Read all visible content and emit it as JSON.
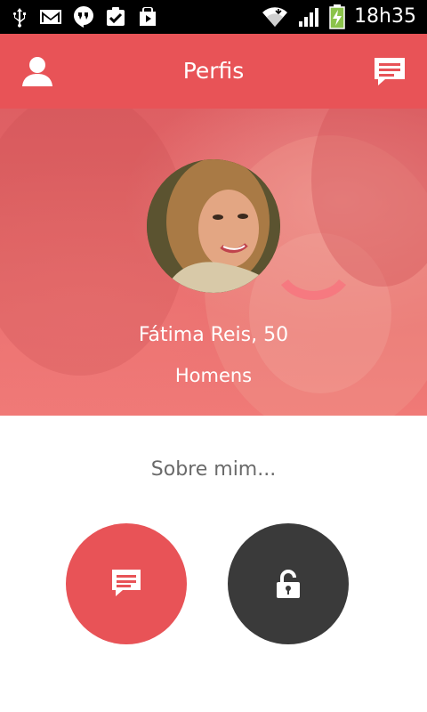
{
  "status_bar": {
    "time": "18h35",
    "left_icons": [
      "usb-icon",
      "gmail-icon",
      "hangouts-icon",
      "tasks-check-icon",
      "play-store-icon"
    ],
    "right_icons": [
      "wifi-icon",
      "signal-icon",
      "battery-charging-icon"
    ]
  },
  "app_bar": {
    "title": "Perfis",
    "left_icon": "person-icon",
    "right_icon": "chat-icon"
  },
  "profile": {
    "name_age": "Fátima Reis, 50",
    "interested_in": "Homens"
  },
  "about": {
    "label": "Sobre mim..."
  },
  "actions": {
    "message_icon": "message-icon",
    "lock_icon": "lock-icon"
  },
  "colors": {
    "primary": "#e85357",
    "dark_button": "#3a3a3a",
    "status_bar": "#000000",
    "text_muted": "#6a6a6a"
  }
}
